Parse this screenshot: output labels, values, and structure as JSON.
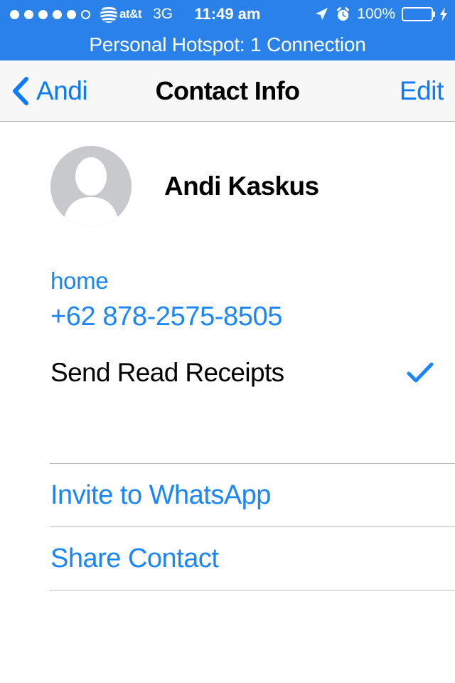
{
  "status_bar": {
    "signal_dots_filled": 5,
    "signal_dots_total": 6,
    "carrier": "at&t",
    "network": "3G",
    "time": "11:49 am",
    "battery_percent": "100%",
    "location_icon": "location-arrow-icon",
    "alarm_icon": "alarm-clock-icon",
    "charging_icon": "lightning-bolt-icon",
    "battery_color": "#4cd964",
    "background_color": "#2a81ea"
  },
  "hotspot_banner": {
    "text": "Personal Hotspot: 1 Connection"
  },
  "nav_bar": {
    "back_label": "Andi",
    "back_icon": "chevron-left-icon",
    "title": "Contact Info",
    "edit_label": "Edit",
    "tint_color": "#0b7bfb",
    "background_color": "#f7f7f7"
  },
  "contact": {
    "name": "Andi Kaskus",
    "avatar_icon": "person-placeholder-icon",
    "avatar_background": "#c8c9cd"
  },
  "phone": {
    "label": "home",
    "number": "+62 878-2575-8505",
    "color": "#1a86fa"
  },
  "read_receipts": {
    "label": "Send Read Receipts",
    "checked": true,
    "check_icon": "checkmark-icon",
    "check_color": "#1a86fa"
  },
  "actions": [
    {
      "label": "Invite to WhatsApp"
    },
    {
      "label": "Share Contact"
    }
  ]
}
